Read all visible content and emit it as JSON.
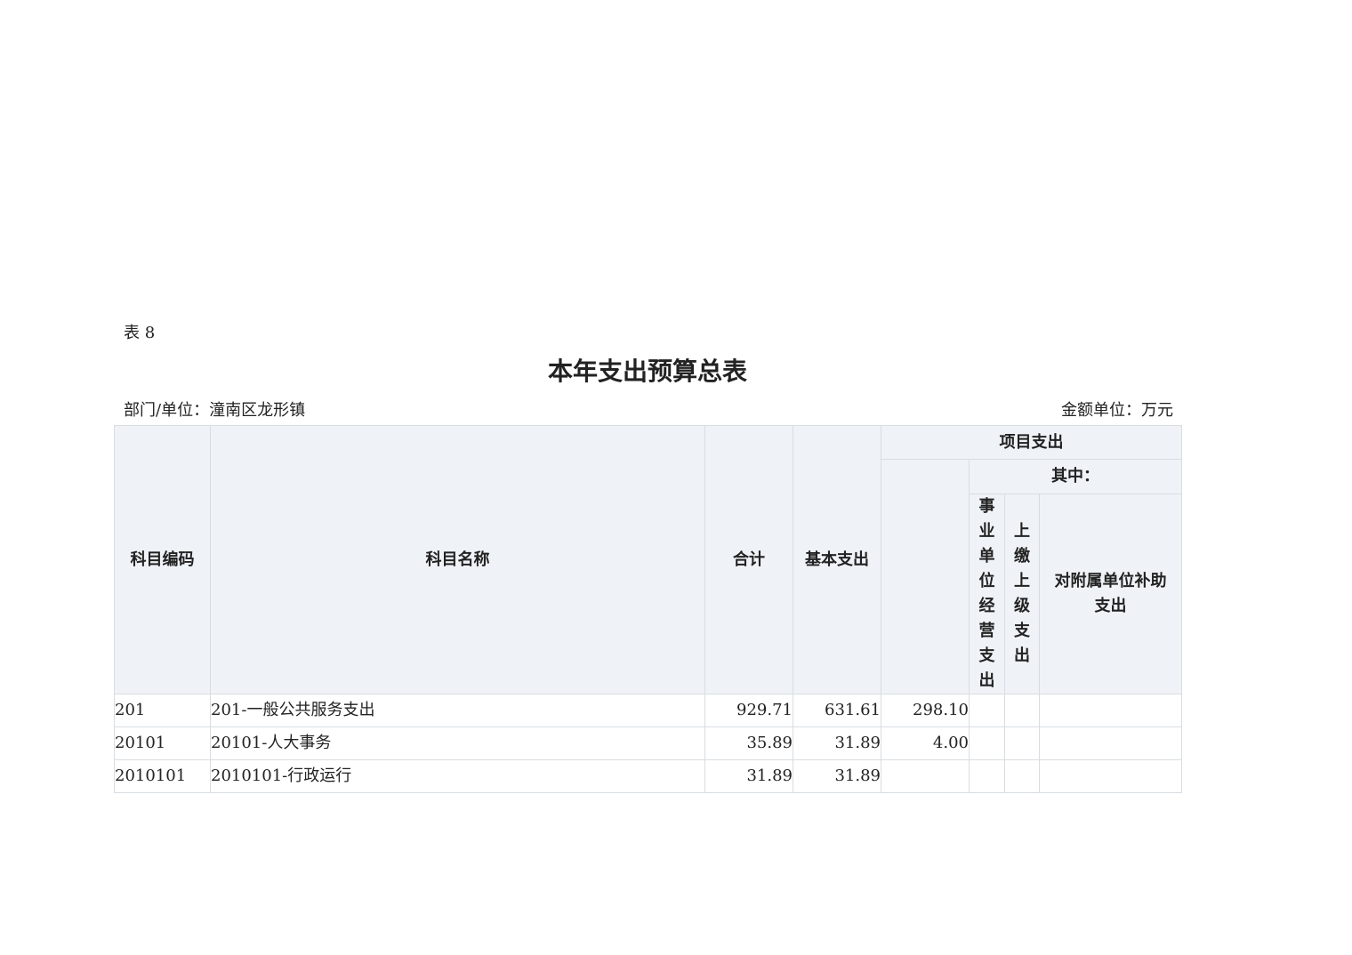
{
  "table_label": "表 8",
  "title": "本年支出预算总表",
  "department": "部门/单位：潼南区龙形镇",
  "unit": "金额单位：万元",
  "headers": {
    "code": "科目编码",
    "name": "科目名称",
    "total": "合计",
    "basic": "基本支出",
    "project": "项目支出",
    "of_which": "其中：",
    "business": "事业单位经营支出",
    "superior": "上缴上级支出",
    "subsidy": "对附属单位补助支出"
  },
  "rows": [
    {
      "code": "201",
      "name": "201-一般公共服务支出",
      "total": "929.71",
      "basic": "631.61",
      "project": "298.10",
      "business": "",
      "superior": "",
      "subsidy": ""
    },
    {
      "code": "20101",
      "name": "20101-人大事务",
      "total": "35.89",
      "basic": "31.89",
      "project": "4.00",
      "business": "",
      "superior": "",
      "subsidy": ""
    },
    {
      "code": "2010101",
      "name": "2010101-行政运行",
      "total": "31.89",
      "basic": "31.89",
      "project": "",
      "business": "",
      "superior": "",
      "subsidy": ""
    }
  ]
}
